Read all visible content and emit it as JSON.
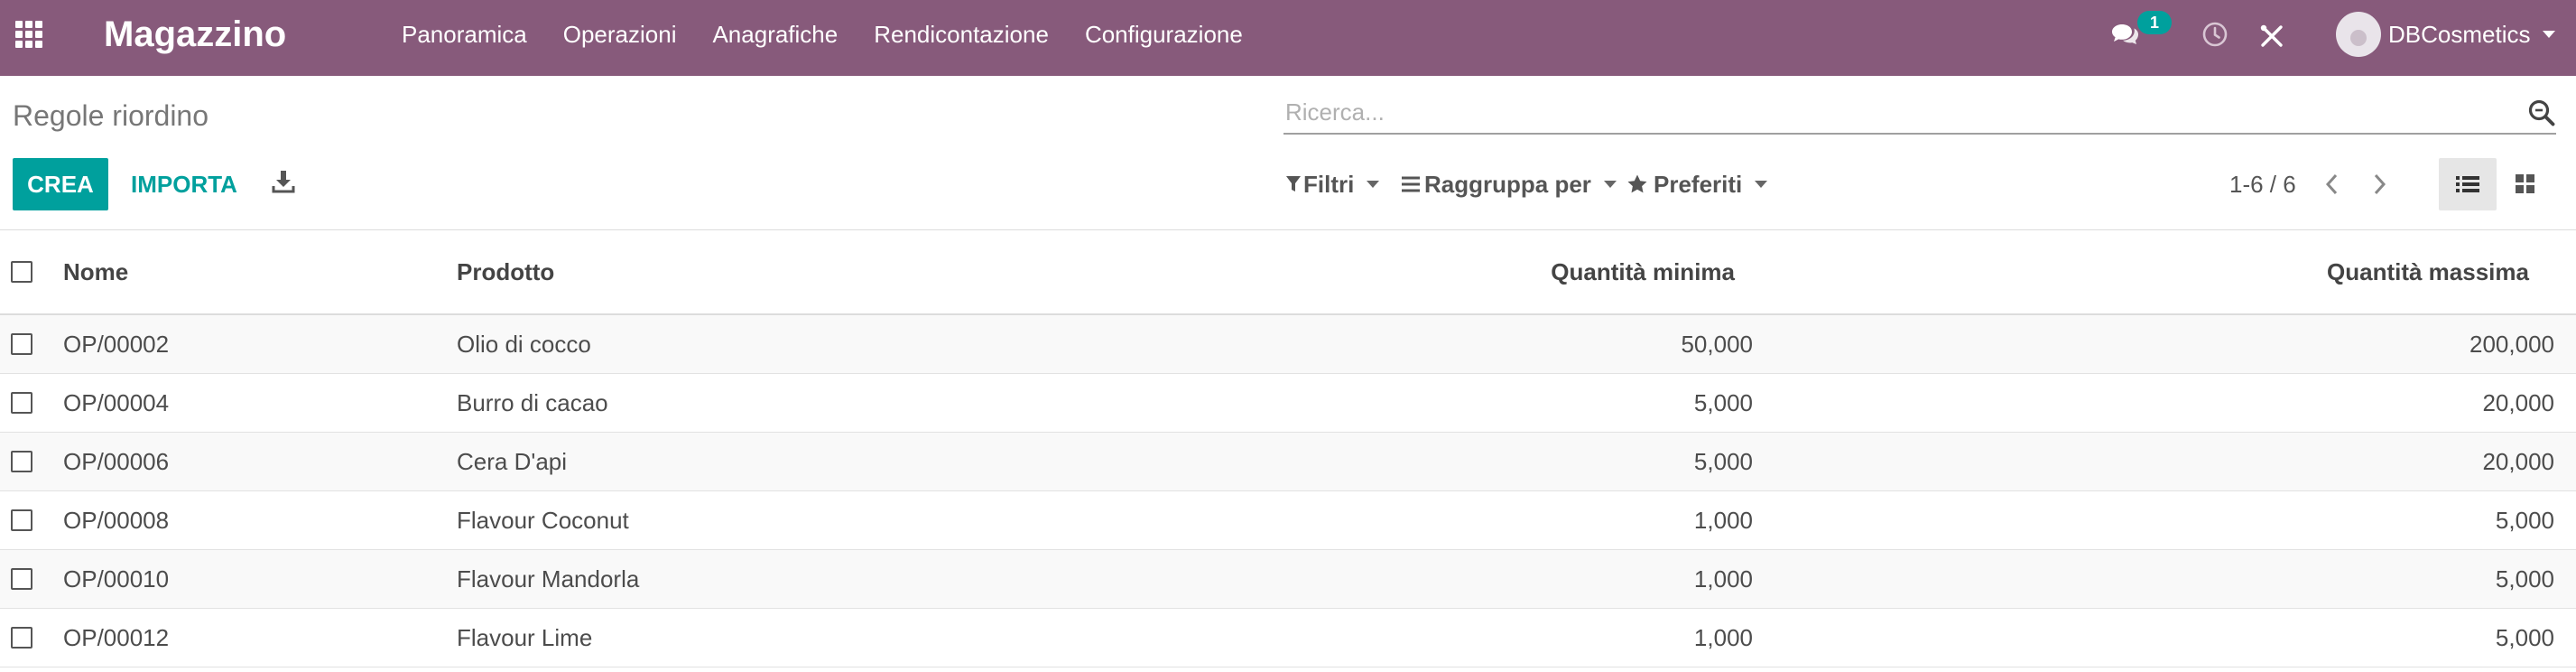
{
  "navbar": {
    "brand": "Magazzino",
    "menu": [
      "Panoramica",
      "Operazioni",
      "Anagrafiche",
      "Rendicontazione",
      "Configurazione"
    ],
    "messages_count": "1",
    "user_name": "DBCosmetics"
  },
  "control_panel": {
    "title": "Regole riordino",
    "search_placeholder": "Ricerca...",
    "create_label": "CREA",
    "import_label": "IMPORTA",
    "filters_label": "Filtri",
    "group_by_label": "Raggruppa per",
    "favorites_label": "Preferiti",
    "pager_value": "1-6 / 6"
  },
  "table": {
    "headers": {
      "name": "Nome",
      "product": "Prodotto",
      "min_qty": "Quantità minima",
      "max_qty": "Quantità massima"
    },
    "rows": [
      {
        "name": "OP/00002",
        "product": "Olio di cocco",
        "min_qty": "50,000",
        "max_qty": "200,000"
      },
      {
        "name": "OP/00004",
        "product": "Burro di cacao",
        "min_qty": "5,000",
        "max_qty": "20,000"
      },
      {
        "name": "OP/00006",
        "product": "Cera D'api",
        "min_qty": "5,000",
        "max_qty": "20,000"
      },
      {
        "name": "OP/00008",
        "product": "Flavour Coconut",
        "min_qty": "1,000",
        "max_qty": "5,000"
      },
      {
        "name": "OP/00010",
        "product": "Flavour Mandorla",
        "min_qty": "1,000",
        "max_qty": "5,000"
      },
      {
        "name": "OP/00012",
        "product": "Flavour Lime",
        "min_qty": "1,000",
        "max_qty": "5,000"
      }
    ]
  },
  "colors": {
    "navbar_bg": "#875a7b",
    "primary": "#00a09d"
  }
}
